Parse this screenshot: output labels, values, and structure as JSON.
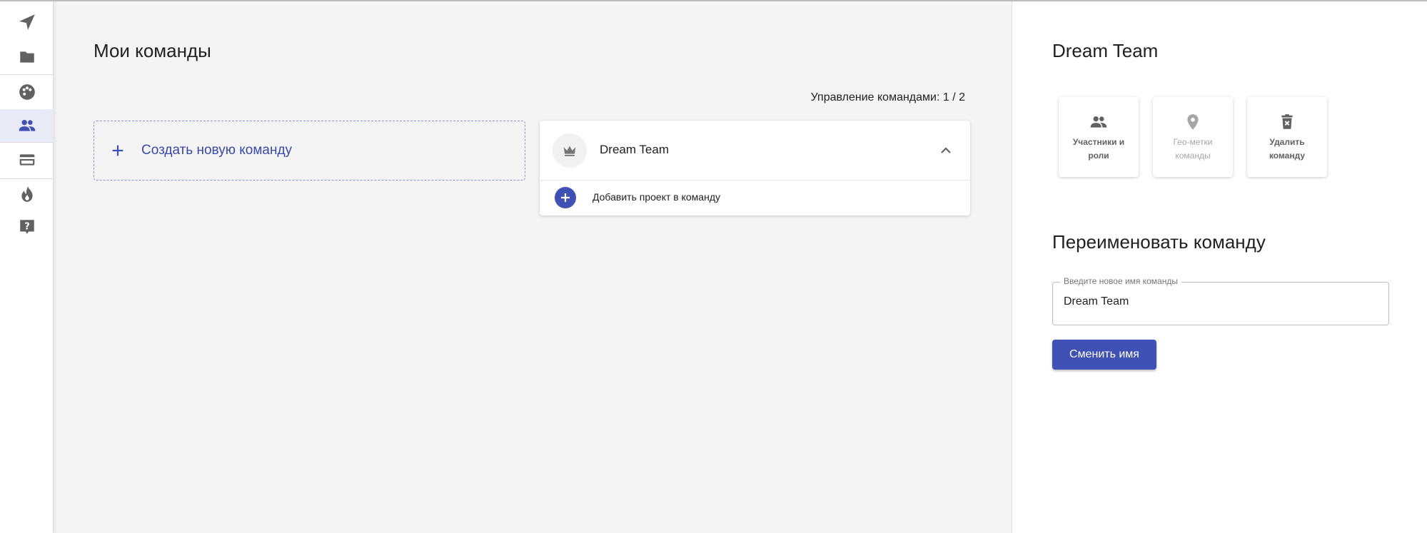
{
  "colors": {
    "accent": "#3f51b5",
    "sidebar_active": "#e8eaf6",
    "main_bg": "#f4f4f4",
    "icon_gray": "#616161",
    "disabled": "#a6a6a6"
  },
  "sidebar": {
    "items": [
      {
        "icon": "send-icon",
        "active": false
      },
      {
        "icon": "folder-icon",
        "active": false
      },
      {
        "icon": "palette-icon",
        "active": false
      },
      {
        "icon": "group-icon",
        "active": true
      },
      {
        "icon": "card-icon",
        "active": false
      },
      {
        "icon": "flame-icon",
        "active": false
      },
      {
        "icon": "help-icon",
        "active": false
      }
    ]
  },
  "main": {
    "title": "Мои команды",
    "manage_count": "Управление командами: 1 / 2",
    "create_team_label": "Создать новую команду",
    "team": {
      "name": "Dream Team",
      "expanded": true,
      "add_project_label": "Добавить проект в команду"
    }
  },
  "panel": {
    "title": "Dream Team",
    "actions": {
      "members": "Участники и роли",
      "geo": "Гео-метки команды",
      "delete": "Удалить команду"
    },
    "rename_title": "Переименовать команду",
    "rename_field_label": "Введите новое имя команды",
    "rename_field_value": "Dream Team",
    "rename_button": "Сменить имя"
  }
}
